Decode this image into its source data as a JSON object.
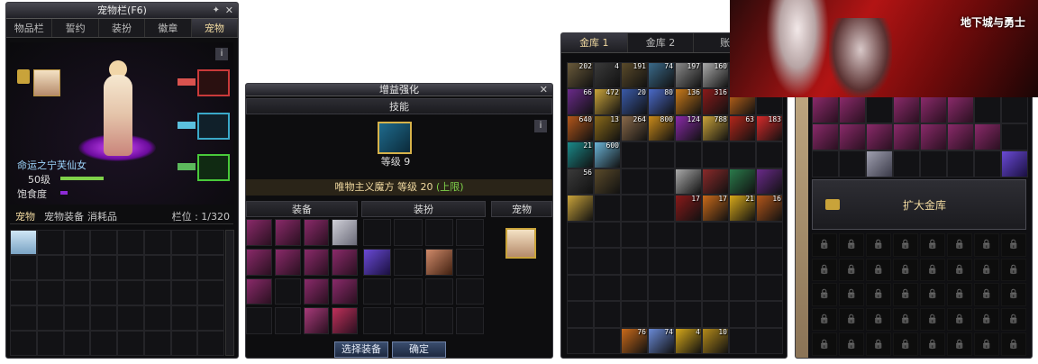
{
  "pet_panel": {
    "title": "宠物栏(F6)",
    "tabs": [
      "物品栏",
      "誓约",
      "装扮",
      "徽章",
      "宠物"
    ],
    "info": "i",
    "pet_name": "命运之宁芙仙女",
    "level": "50级",
    "satiety_label": "饱食度",
    "bottom_tabs": [
      "宠物",
      "宠物装备",
      "消耗品"
    ],
    "capacity": "栏位 : 1/320"
  },
  "enhance_panel": {
    "title": "增益强化",
    "skill_header": "技能",
    "info": "i",
    "skill_level": "等级 9",
    "skill_line": "唯物主义魔方 等级 20",
    "skill_limit": "(上限)",
    "col_equip": "装备",
    "col_avatar": "装扮",
    "col_pet": "宠物",
    "btn_select": "选择装备",
    "btn_confirm": "确定"
  },
  "vault_panel": {
    "tabs": [
      "金库 1",
      "金库 2",
      "账号金库"
    ],
    "counts": [
      "202",
      "4",
      "191",
      "74",
      "197",
      "160",
      "66",
      "472",
      "20",
      "80",
      "136",
      "316",
      "640",
      "13",
      "264",
      "800",
      "124",
      "788",
      "63",
      "183",
      "21",
      "600",
      "56",
      "17",
      "17",
      "21",
      "16",
      "76",
      "74",
      "4",
      "10"
    ]
  },
  "right_panel": {
    "expand_label": "扩大金库",
    "banner_text": "地下城与勇士"
  },
  "colors": {
    "gold": "#f0d9a0",
    "green": "#7fd14a",
    "purple": "#8e2bd6"
  }
}
